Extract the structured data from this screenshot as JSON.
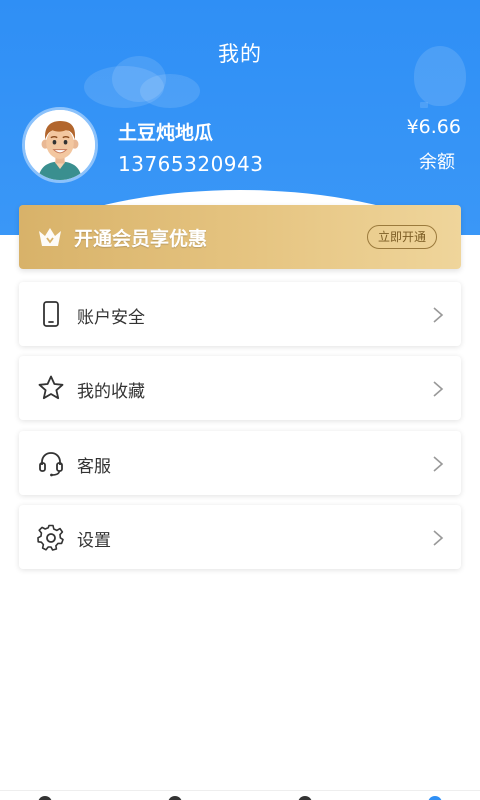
{
  "header": {
    "title": "我的",
    "bg_color": "#2f8ff5"
  },
  "profile": {
    "name": "土豆炖地瓜",
    "phone": "13765320943",
    "balance": "¥6.66",
    "balance_label": "余额"
  },
  "vip": {
    "text": "开通会员享优惠",
    "button": "立即开通",
    "icon": "crown-icon",
    "colors": {
      "from": "#d8b269",
      "to": "#efd59b"
    }
  },
  "menu": [
    {
      "label": "账户安全",
      "icon": "phone-icon"
    },
    {
      "label": "我的收藏",
      "icon": "star-icon"
    },
    {
      "label": "客服",
      "icon": "headset-icon"
    },
    {
      "label": "设置",
      "icon": "gear-icon"
    }
  ],
  "tabbar": {
    "active_color": "#2f8ff5"
  }
}
